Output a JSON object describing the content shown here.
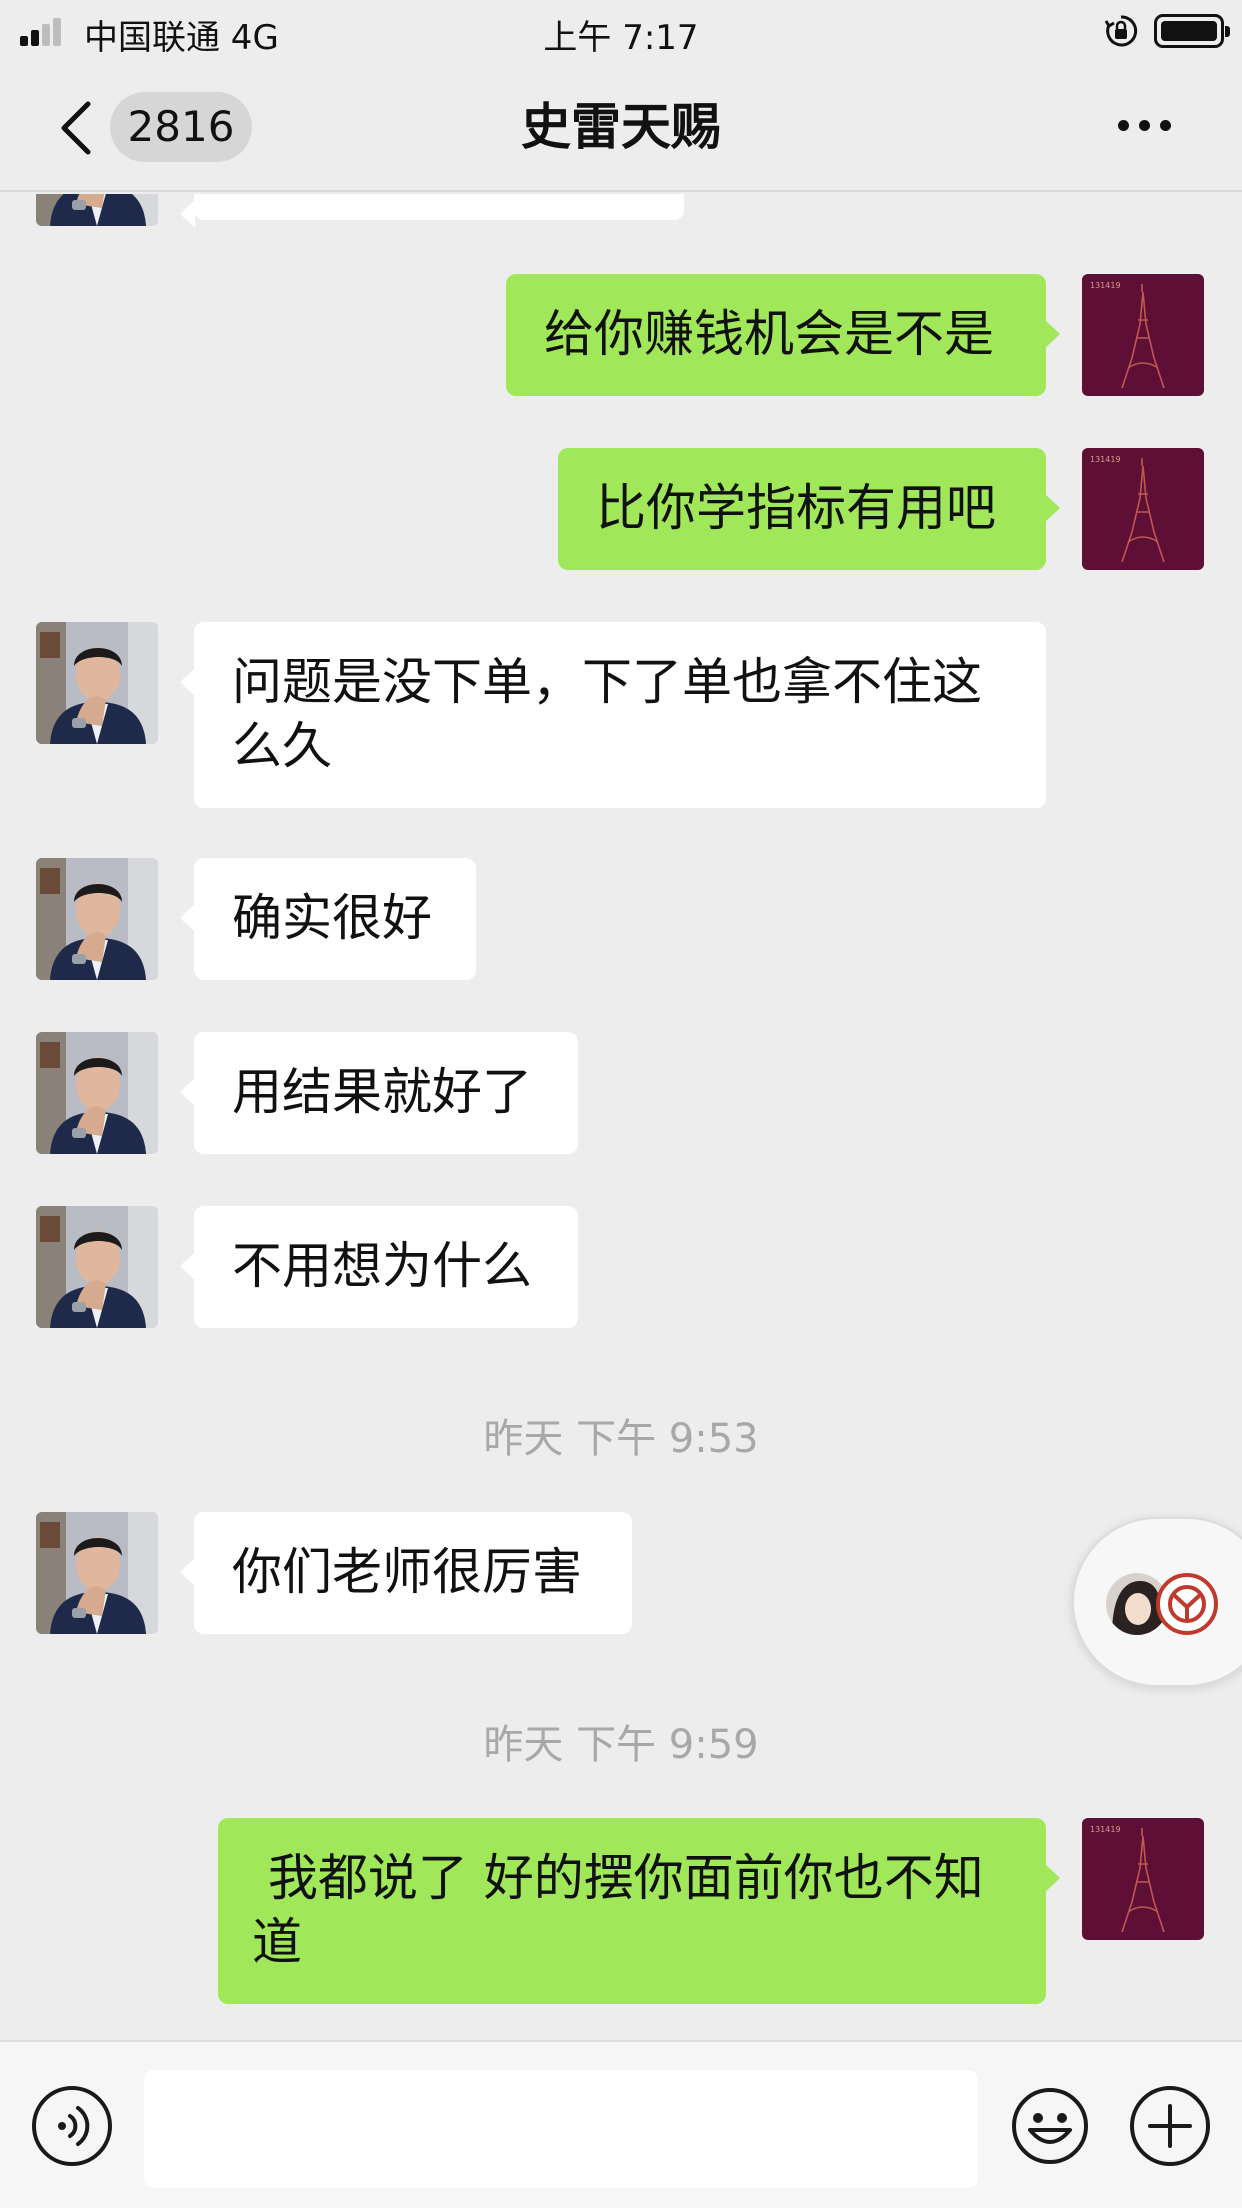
{
  "status_bar": {
    "carrier": "中国联通   4G",
    "time": "上午 7:17"
  },
  "nav": {
    "back_icon": "chevron-left-icon",
    "unread_count": "2816",
    "title": "史雷天赐",
    "more_icon": "ellipsis-icon"
  },
  "messages": [
    {
      "side": "left",
      "text": ""
    },
    {
      "side": "right",
      "text": "给你赚钱机会是不是"
    },
    {
      "side": "right",
      "text": "比你学指标有用吧"
    },
    {
      "side": "left",
      "text": "问题是没下单，下了单也拿不住这么久"
    },
    {
      "side": "left",
      "text": "确实很好"
    },
    {
      "side": "left",
      "text": "用结果就好了"
    },
    {
      "side": "left",
      "text": "不用想为什么"
    },
    {
      "side": "left",
      "text": "你们老师很厉害"
    },
    {
      "side": "right",
      "text": " 我都说了 好的摆你面前你也不知道"
    }
  ],
  "timestamps": [
    "昨天 下午 9:53",
    "昨天 下午 9:59"
  ],
  "input_bar": {
    "voice_icon": "voice-icon",
    "input_value": "",
    "emoji_icon": "emoji-icon",
    "plus_icon": "plus-icon"
  },
  "colors": {
    "background": "#ededed",
    "sent_bubble": "#a0e75a",
    "received_bubble": "#ffffff",
    "timestamp_text": "#a8a8a8"
  }
}
